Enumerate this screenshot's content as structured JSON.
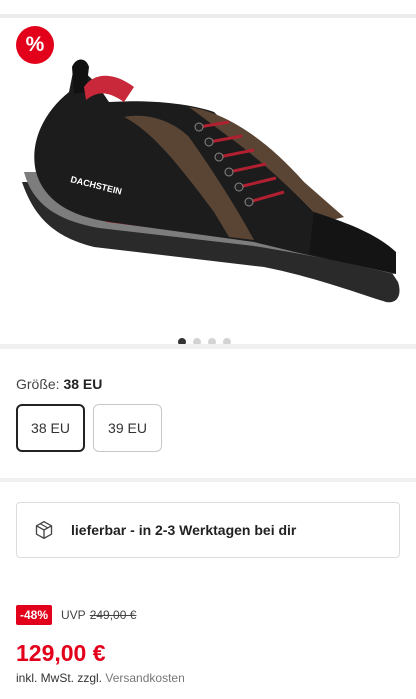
{
  "gallery": {
    "badge": "%",
    "image_alt": "Trekking shoe",
    "brand_on_shoe": "DACHSTEIN",
    "dots": [
      true,
      false,
      false,
      false
    ]
  },
  "size": {
    "label": "Größe:",
    "selected": "38 EU",
    "options": [
      "38 EU",
      "39 EU"
    ]
  },
  "delivery": {
    "text": "lieferbar - in 2-3 Werktagen bei dir"
  },
  "price": {
    "discount": "-48%",
    "uvp_label": "UVP",
    "uvp_price": "249,00 €",
    "current": "129,00 €",
    "tax_text": "inkl. MwSt. zzgl.",
    "shipping_link": "Versandkosten"
  },
  "colors": {
    "accent": "#e2001a"
  }
}
